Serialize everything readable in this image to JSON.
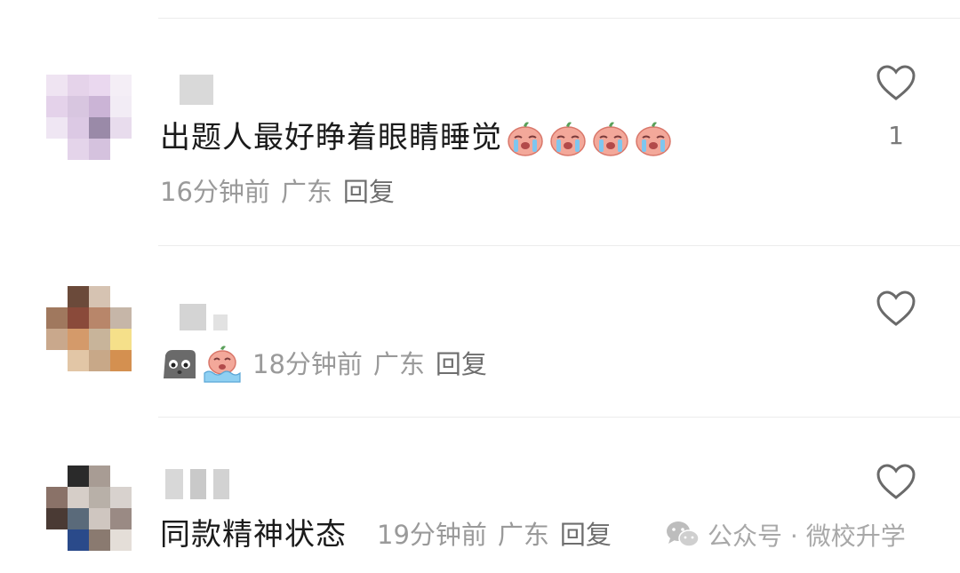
{
  "comments": [
    {
      "text": "出题人最好睁着眼睛睡觉",
      "time": "16分钟前",
      "location": "广东",
      "reply": "回复",
      "like_count": "1",
      "emojis": [
        "crying-emoji",
        "crying-emoji",
        "crying-emoji",
        "crying-emoji"
      ]
    },
    {
      "text": "",
      "time": "18分钟前",
      "location": "广东",
      "reply": "回复",
      "like_count": "",
      "emojis": [
        "rock-face-emoji",
        "crying-in-water-emoji"
      ]
    },
    {
      "text": "同款精神状态",
      "time": "19分钟前",
      "location": "广东",
      "reply": "回复",
      "like_count": "",
      "emojis": []
    }
  ],
  "watermark": {
    "icon": "wechat-icon",
    "text": "公众号 · 微校升学"
  },
  "colors": {
    "text": "#1b1b1b",
    "meta": "#9a9a9a",
    "divider": "#ececec"
  }
}
